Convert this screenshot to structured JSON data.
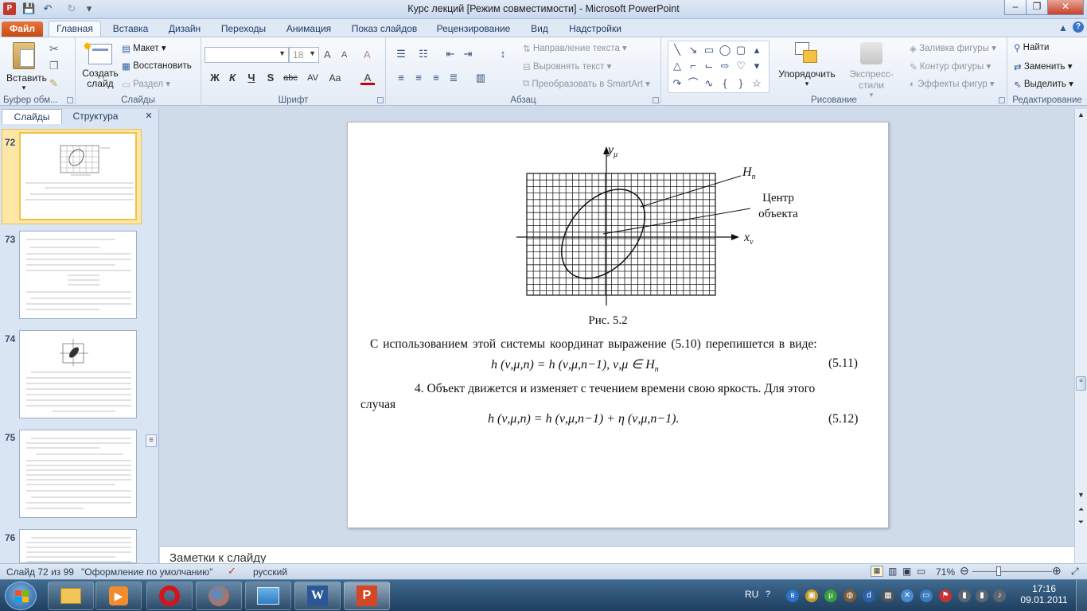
{
  "window": {
    "title": "Курс лекций [Режим совместимости]  -  Microsoft PowerPoint",
    "controls": {
      "minimize": "–",
      "restore": "❐",
      "close": "✕"
    }
  },
  "qat": {
    "save": "💾",
    "undo": "↶",
    "redo": "↻",
    "more": "▾"
  },
  "tabs": [
    {
      "label": "Файл"
    },
    {
      "label": "Главная"
    },
    {
      "label": "Вставка"
    },
    {
      "label": "Дизайн"
    },
    {
      "label": "Переходы"
    },
    {
      "label": "Анимация"
    },
    {
      "label": "Показ слайдов"
    },
    {
      "label": "Рецензирование"
    },
    {
      "label": "Вид"
    },
    {
      "label": "Надстройки"
    }
  ],
  "ribbon": {
    "clipboard": {
      "label": "Буфер обм...",
      "paste": "Вставить"
    },
    "slides": {
      "label": "Слайды",
      "new_slide": "Создать слайд",
      "layout": "Макет",
      "reset": "Восстановить",
      "section": "Раздел"
    },
    "font": {
      "label": "Шрифт",
      "size": "18",
      "bold": "Ж",
      "italic": "К",
      "underline": "Ч",
      "shadow": "S",
      "strike": "abc",
      "spacing": "AV",
      "case": "Aa",
      "color": "A",
      "grow": "A",
      "shrink": "A",
      "clear": "A"
    },
    "paragraph": {
      "label": "Абзац",
      "text_direction": "Направление текста",
      "align_text": "Выровнять текст",
      "smartart": "Преобразовать в SmartArt"
    },
    "drawing": {
      "label": "Рисование",
      "arrange": "Упорядочить",
      "quick_styles": "Экспресс-стили",
      "fill": "Заливка фигуры",
      "outline": "Контур фигуры",
      "effects": "Эффекты фигур"
    },
    "editing": {
      "label": "Редактирование",
      "find": "Найти",
      "replace": "Заменить",
      "select": "Выделить"
    }
  },
  "left_pane": {
    "tabs": [
      "Слайды",
      "Структура"
    ],
    "close": "✕",
    "thumbnails": [
      {
        "number": "72",
        "selected": true
      },
      {
        "number": "73",
        "selected": false
      },
      {
        "number": "74",
        "selected": false
      },
      {
        "number": "75",
        "selected": false
      },
      {
        "number": "76",
        "selected": false
      }
    ]
  },
  "slide": {
    "axis_y": "y",
    "axis_y_sub": "μ",
    "axis_x": "x",
    "axis_x_sub": "ν",
    "label_h": "H",
    "label_h_sub": "n",
    "center_line1": "Центр",
    "center_line2": "объекта",
    "caption": "Рис. 5.2",
    "paragraph1": "С использованием этой системы координат выражение (5.10) перепишется в виде:",
    "formula1": "h (ν,μ,n) = h (ν,μ,n−1),      ν,μ ∈ H",
    "formula1_sub": "n",
    "formula1_no": "(5.11)",
    "paragraph2": "4. Объект движется и изменяет с течением времени свою яркость. Для этого",
    "paragraph2b": "случая",
    "formula2": "h (ν,μ,n) = h (ν,μ,n−1) + η (ν,μ,n−1).",
    "formula2_no": "(5.12)"
  },
  "notes": {
    "placeholder": "Заметки к слайду"
  },
  "status": {
    "slide_info": "Слайд 72 из 99",
    "theme": "\"Оформление по умолчанию\"",
    "language": "русский",
    "zoom": "71%"
  },
  "taskbar": {
    "lang": "RU",
    "time": "17:16",
    "date": "09.01.2011"
  }
}
